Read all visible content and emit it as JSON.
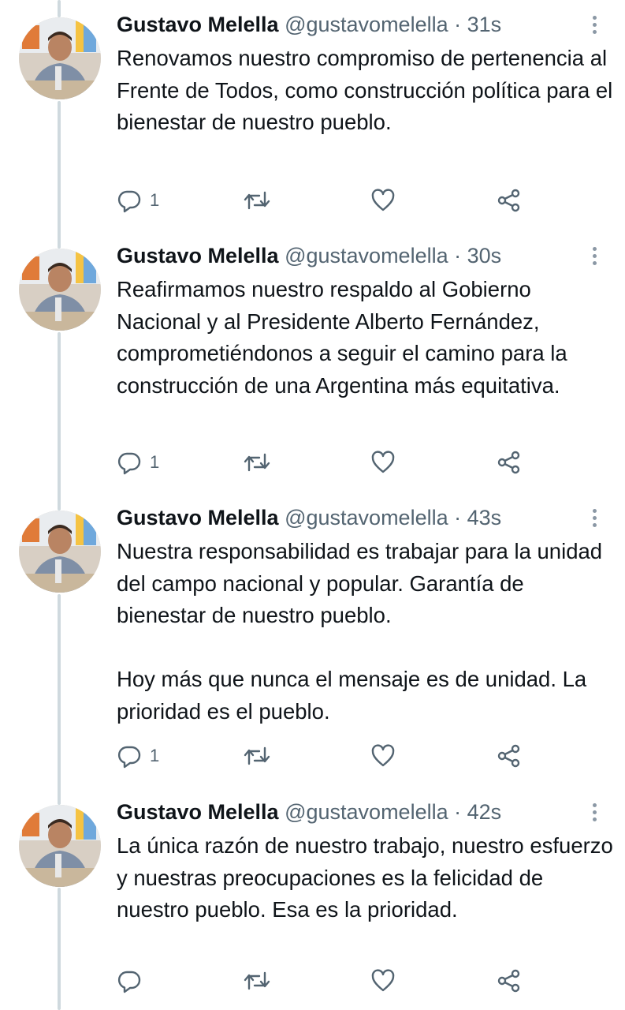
{
  "tweets": [
    {
      "author": "Gustavo Melella",
      "handle": "@gustavomelella",
      "separator": "·",
      "time": "31s",
      "text": "Renovamos nuestro compromiso de pertenencia al Frente de Todos, como construcción política para el bienestar de nuestro pueblo.",
      "reply_count": "1"
    },
    {
      "author": "Gustavo Melella",
      "handle": "@gustavomelella",
      "separator": "·",
      "time": "30s",
      "text": "Reafirmamos nuestro respaldo al Gobierno Nacional y al Presidente Alberto Fernández, comprometiéndonos a seguir el camino para la construcción de una Argentina más equitativa.",
      "reply_count": "1"
    },
    {
      "author": "Gustavo Melella",
      "handle": "@gustavomelella",
      "separator": "·",
      "time": "43s",
      "text": "Nuestra responsabilidad es trabajar para la unidad del campo nacional y popular. Garantía de bienestar de nuestro pueblo.\n\nHoy más que nunca el mensaje es de unidad. La prioridad es el pueblo.",
      "reply_count": "1"
    },
    {
      "author": "Gustavo Melella",
      "handle": "@gustavomelella",
      "separator": "·",
      "time": "42s",
      "text": "La única razón de nuestro trabajo, nuestro esfuerzo y nuestras preocupaciones es la felicidad de nuestro pueblo. Esa es la prioridad.",
      "reply_count": ""
    }
  ],
  "icons": {
    "reply": "reply-icon",
    "retweet": "retweet-icon",
    "like": "like-icon",
    "share": "share-icon",
    "more": "more-icon"
  },
  "colors": {
    "text": "#0f1419",
    "secondary": "#536471",
    "thread_line": "#cfd9de",
    "icon": "#536471"
  }
}
